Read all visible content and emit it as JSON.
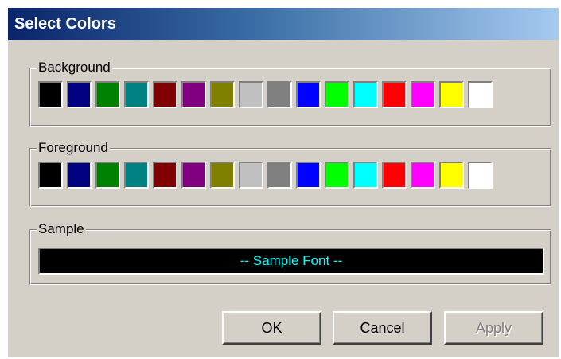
{
  "dialog": {
    "title": "Select Colors"
  },
  "palette": [
    "#000000",
    "#000080",
    "#008000",
    "#008080",
    "#800000",
    "#800080",
    "#808000",
    "#c0c0c0",
    "#808080",
    "#0000ff",
    "#00ff00",
    "#00ffff",
    "#ff0000",
    "#ff00ff",
    "#ffff00",
    "#ffffff"
  ],
  "background_group": {
    "label": "Background"
  },
  "foreground_group": {
    "label": "Foreground"
  },
  "sample_group": {
    "label": "Sample",
    "text": "-- Sample Font --",
    "background_color": "#000000",
    "text_color": "#00ffff"
  },
  "buttons": {
    "ok": "OK",
    "cancel": "Cancel",
    "apply": "Apply",
    "apply_enabled": false
  }
}
